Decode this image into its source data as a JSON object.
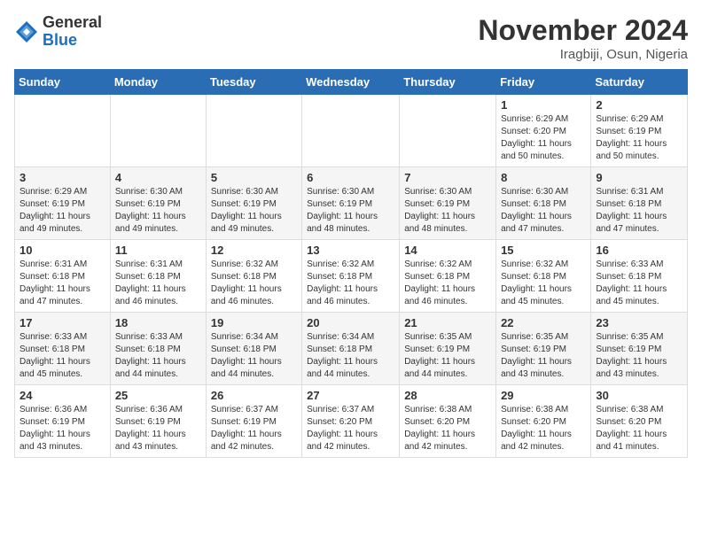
{
  "header": {
    "logo_general": "General",
    "logo_blue": "Blue",
    "month_title": "November 2024",
    "location": "Iragbiji, Osun, Nigeria"
  },
  "days_of_week": [
    "Sunday",
    "Monday",
    "Tuesday",
    "Wednesday",
    "Thursday",
    "Friday",
    "Saturday"
  ],
  "weeks": [
    [
      {
        "day": "",
        "info": ""
      },
      {
        "day": "",
        "info": ""
      },
      {
        "day": "",
        "info": ""
      },
      {
        "day": "",
        "info": ""
      },
      {
        "day": "",
        "info": ""
      },
      {
        "day": "1",
        "info": "Sunrise: 6:29 AM\nSunset: 6:20 PM\nDaylight: 11 hours and 50 minutes."
      },
      {
        "day": "2",
        "info": "Sunrise: 6:29 AM\nSunset: 6:19 PM\nDaylight: 11 hours and 50 minutes."
      }
    ],
    [
      {
        "day": "3",
        "info": "Sunrise: 6:29 AM\nSunset: 6:19 PM\nDaylight: 11 hours and 49 minutes."
      },
      {
        "day": "4",
        "info": "Sunrise: 6:30 AM\nSunset: 6:19 PM\nDaylight: 11 hours and 49 minutes."
      },
      {
        "day": "5",
        "info": "Sunrise: 6:30 AM\nSunset: 6:19 PM\nDaylight: 11 hours and 49 minutes."
      },
      {
        "day": "6",
        "info": "Sunrise: 6:30 AM\nSunset: 6:19 PM\nDaylight: 11 hours and 48 minutes."
      },
      {
        "day": "7",
        "info": "Sunrise: 6:30 AM\nSunset: 6:19 PM\nDaylight: 11 hours and 48 minutes."
      },
      {
        "day": "8",
        "info": "Sunrise: 6:30 AM\nSunset: 6:18 PM\nDaylight: 11 hours and 47 minutes."
      },
      {
        "day": "9",
        "info": "Sunrise: 6:31 AM\nSunset: 6:18 PM\nDaylight: 11 hours and 47 minutes."
      }
    ],
    [
      {
        "day": "10",
        "info": "Sunrise: 6:31 AM\nSunset: 6:18 PM\nDaylight: 11 hours and 47 minutes."
      },
      {
        "day": "11",
        "info": "Sunrise: 6:31 AM\nSunset: 6:18 PM\nDaylight: 11 hours and 46 minutes."
      },
      {
        "day": "12",
        "info": "Sunrise: 6:32 AM\nSunset: 6:18 PM\nDaylight: 11 hours and 46 minutes."
      },
      {
        "day": "13",
        "info": "Sunrise: 6:32 AM\nSunset: 6:18 PM\nDaylight: 11 hours and 46 minutes."
      },
      {
        "day": "14",
        "info": "Sunrise: 6:32 AM\nSunset: 6:18 PM\nDaylight: 11 hours and 46 minutes."
      },
      {
        "day": "15",
        "info": "Sunrise: 6:32 AM\nSunset: 6:18 PM\nDaylight: 11 hours and 45 minutes."
      },
      {
        "day": "16",
        "info": "Sunrise: 6:33 AM\nSunset: 6:18 PM\nDaylight: 11 hours and 45 minutes."
      }
    ],
    [
      {
        "day": "17",
        "info": "Sunrise: 6:33 AM\nSunset: 6:18 PM\nDaylight: 11 hours and 45 minutes."
      },
      {
        "day": "18",
        "info": "Sunrise: 6:33 AM\nSunset: 6:18 PM\nDaylight: 11 hours and 44 minutes."
      },
      {
        "day": "19",
        "info": "Sunrise: 6:34 AM\nSunset: 6:18 PM\nDaylight: 11 hours and 44 minutes."
      },
      {
        "day": "20",
        "info": "Sunrise: 6:34 AM\nSunset: 6:18 PM\nDaylight: 11 hours and 44 minutes."
      },
      {
        "day": "21",
        "info": "Sunrise: 6:35 AM\nSunset: 6:19 PM\nDaylight: 11 hours and 44 minutes."
      },
      {
        "day": "22",
        "info": "Sunrise: 6:35 AM\nSunset: 6:19 PM\nDaylight: 11 hours and 43 minutes."
      },
      {
        "day": "23",
        "info": "Sunrise: 6:35 AM\nSunset: 6:19 PM\nDaylight: 11 hours and 43 minutes."
      }
    ],
    [
      {
        "day": "24",
        "info": "Sunrise: 6:36 AM\nSunset: 6:19 PM\nDaylight: 11 hours and 43 minutes."
      },
      {
        "day": "25",
        "info": "Sunrise: 6:36 AM\nSunset: 6:19 PM\nDaylight: 11 hours and 43 minutes."
      },
      {
        "day": "26",
        "info": "Sunrise: 6:37 AM\nSunset: 6:19 PM\nDaylight: 11 hours and 42 minutes."
      },
      {
        "day": "27",
        "info": "Sunrise: 6:37 AM\nSunset: 6:20 PM\nDaylight: 11 hours and 42 minutes."
      },
      {
        "day": "28",
        "info": "Sunrise: 6:38 AM\nSunset: 6:20 PM\nDaylight: 11 hours and 42 minutes."
      },
      {
        "day": "29",
        "info": "Sunrise: 6:38 AM\nSunset: 6:20 PM\nDaylight: 11 hours and 42 minutes."
      },
      {
        "day": "30",
        "info": "Sunrise: 6:38 AM\nSunset: 6:20 PM\nDaylight: 11 hours and 41 minutes."
      }
    ]
  ]
}
